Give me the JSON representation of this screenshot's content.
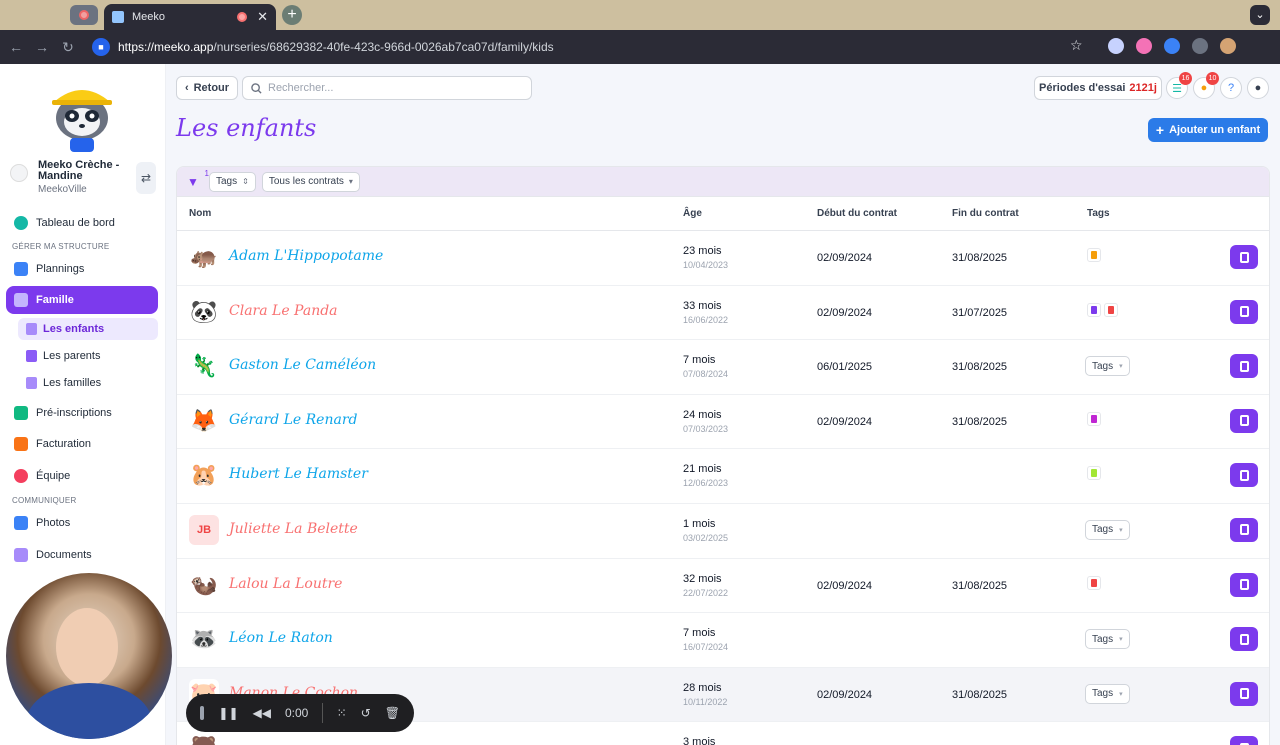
{
  "browser": {
    "tab_title": "Meeko",
    "url_host": "https://meeko.app",
    "url_path": "/nurseries/68629382-40fe-423c-966d-0026ab7ca07d/family/kids"
  },
  "sidebar": {
    "org_name": "Meeko Crèche - Mandine",
    "org_city": "MeekoVille",
    "dashboard": "Tableau de bord",
    "section_manage": "GÉRER MA STRUCTURE",
    "plannings": "Plannings",
    "famille": "Famille",
    "sub_enfants": "Les enfants",
    "sub_parents": "Les parents",
    "sub_familles": "Les familles",
    "preinscriptions": "Pré-inscriptions",
    "facturation": "Facturation",
    "equipe": "Équipe",
    "section_communicate": "COMMUNIQUER",
    "photos": "Photos",
    "documents": "Documents"
  },
  "header": {
    "back_label": "Retour",
    "search_placeholder": "Rechercher...",
    "trial_label": "Périodes d'essai",
    "trial_days": "2121j",
    "tasks_badge": "16",
    "notif_badge": "10",
    "help": "?"
  },
  "page": {
    "title": "Les enfants",
    "add_button": "Ajouter un enfant"
  },
  "filters": {
    "filter_count": "1",
    "tags_label": "Tags",
    "contracts_label": "Tous les contrats"
  },
  "table": {
    "columns": {
      "name": "Nom",
      "age": "Âge",
      "start": "Début du contrat",
      "end": "Fin du contrat",
      "tags": "Tags"
    },
    "rows": [
      {
        "name": "Adam L'Hippopotame",
        "age": "23 mois",
        "birth": "10/04/2023",
        "start": "02/09/2024",
        "end": "31/08/2025",
        "tags": [
          "#f59e0b"
        ],
        "tags_select": "",
        "name_color": "#0ea5e9",
        "avatar": "🦛",
        "avatar_bg": "#ffffff"
      },
      {
        "name": "Clara Le Panda",
        "age": "33 mois",
        "birth": "16/06/2022",
        "start": "02/09/2024",
        "end": "31/07/2025",
        "tags": [
          "#7c3aed",
          "#ef4444"
        ],
        "tags_select": "",
        "name_color": "#f87171",
        "avatar": "🐼",
        "avatar_bg": "#ffffff"
      },
      {
        "name": "Gaston Le Caméléon",
        "age": "7 mois",
        "birth": "07/08/2024",
        "start": "06/01/2025",
        "end": "31/08/2025",
        "tags": [],
        "tags_select": "Tags",
        "name_color": "#0ea5e9",
        "avatar": "🦎",
        "avatar_bg": "#ffffff"
      },
      {
        "name": "Gérard Le Renard",
        "age": "24 mois",
        "birth": "07/03/2023",
        "start": "02/09/2024",
        "end": "31/08/2025",
        "tags": [
          "#c026d3"
        ],
        "tags_select": "",
        "name_color": "#0ea5e9",
        "avatar": "🦊",
        "avatar_bg": "#ffffff"
      },
      {
        "name": "Hubert Le Hamster",
        "age": "21 mois",
        "birth": "12/06/2023",
        "start": "",
        "end": "",
        "tags": [
          "#a3e635"
        ],
        "tags_select": "",
        "name_color": "#0ea5e9",
        "avatar": "🐹",
        "avatar_bg": "#ffffff"
      },
      {
        "name": "Juliette La Belette",
        "age": "1 mois",
        "birth": "03/02/2025",
        "start": "",
        "end": "",
        "tags": [],
        "tags_select": "Tags",
        "name_color": "#f87171",
        "avatar": "JB",
        "avatar_bg": "#fde2e2"
      },
      {
        "name": "Lalou La Loutre",
        "age": "32 mois",
        "birth": "22/07/2022",
        "start": "02/09/2024",
        "end": "31/08/2025",
        "tags": [
          "#ef4444"
        ],
        "tags_select": "",
        "name_color": "#f87171",
        "avatar": "🦦",
        "avatar_bg": "#ffffff"
      },
      {
        "name": "Léon Le Raton",
        "age": "7 mois",
        "birth": "16/07/2024",
        "start": "",
        "end": "",
        "tags": [],
        "tags_select": "Tags",
        "name_color": "#0ea5e9",
        "avatar": "🦝",
        "avatar_bg": "#ffffff"
      },
      {
        "name": "Manon Le Cochon",
        "age": "28 mois",
        "birth": "10/11/2022",
        "start": "02/09/2024",
        "end": "31/08/2025",
        "tags": [],
        "tags_select": "Tags",
        "name_color": "#f87171",
        "avatar": "🐷",
        "avatar_bg": "#ffffff"
      },
      {
        "name": "",
        "age": "3 mois",
        "birth": "",
        "start": "",
        "end": "",
        "tags": [],
        "tags_select": "",
        "name_color": "#0ea5e9",
        "avatar": "🐻",
        "avatar_bg": "#ffffff"
      }
    ]
  },
  "recorder": {
    "time": "0:00"
  }
}
